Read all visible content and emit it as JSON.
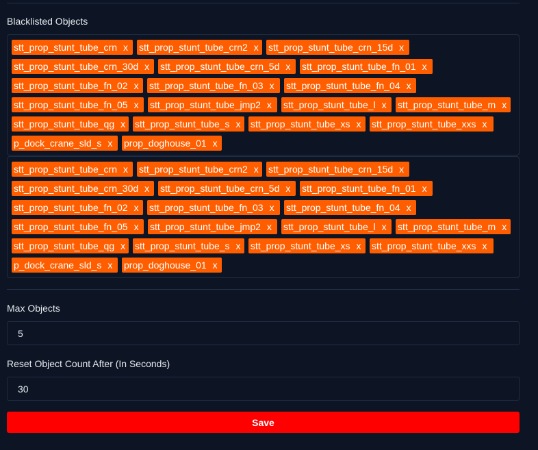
{
  "blacklist": {
    "label": "Blacklisted Objects",
    "remove_glyph": "x",
    "selected_tags": [
      "stt_prop_stunt_tube_crn",
      "stt_prop_stunt_tube_crn2",
      "stt_prop_stunt_tube_crn_15d",
      "stt_prop_stunt_tube_crn_30d",
      "stt_prop_stunt_tube_crn_5d",
      "stt_prop_stunt_tube_fn_01",
      "stt_prop_stunt_tube_fn_02",
      "stt_prop_stunt_tube_fn_03",
      "stt_prop_stunt_tube_fn_04",
      "stt_prop_stunt_tube_fn_05",
      "stt_prop_stunt_tube_jmp2",
      "stt_prop_stunt_tube_l",
      "stt_prop_stunt_tube_m",
      "stt_prop_stunt_tube_qg",
      "stt_prop_stunt_tube_s",
      "stt_prop_stunt_tube_xs",
      "stt_prop_stunt_tube_xxs",
      "p_dock_crane_sld_s",
      "prop_doghouse_01"
    ],
    "dropdown_tags": [
      "stt_prop_stunt_tube_crn",
      "stt_prop_stunt_tube_crn2",
      "stt_prop_stunt_tube_crn_15d",
      "stt_prop_stunt_tube_crn_30d",
      "stt_prop_stunt_tube_crn_5d",
      "stt_prop_stunt_tube_fn_01",
      "stt_prop_stunt_tube_fn_02",
      "stt_prop_stunt_tube_fn_03",
      "stt_prop_stunt_tube_fn_04",
      "stt_prop_stunt_tube_fn_05",
      "stt_prop_stunt_tube_jmp2",
      "stt_prop_stunt_tube_l",
      "stt_prop_stunt_tube_m",
      "stt_prop_stunt_tube_qg",
      "stt_prop_stunt_tube_s",
      "stt_prop_stunt_tube_xs",
      "stt_prop_stunt_tube_xxs",
      "p_dock_crane_sld_s",
      "prop_doghouse_01"
    ]
  },
  "max_objects": {
    "label": "Max Objects",
    "value": "5"
  },
  "reset_count": {
    "label": "Reset Object Count After (In Seconds)",
    "value": "30"
  },
  "save_label": "Save",
  "colors": {
    "background": "#0d1525",
    "tag": "#ff5e00",
    "save": "#ff0000"
  }
}
